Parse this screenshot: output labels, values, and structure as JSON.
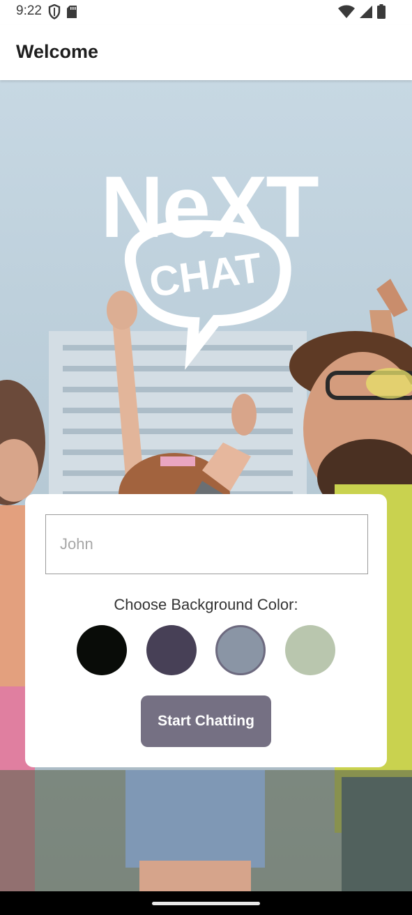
{
  "status_bar": {
    "time": "9:22",
    "left_icons": [
      "shield-icon",
      "sd-card-icon"
    ],
    "right_icons": [
      "wifi-icon",
      "cell-signal-icon",
      "battery-icon"
    ]
  },
  "app_bar": {
    "title": "Welcome"
  },
  "hero": {
    "logo_text_top": "NeXT",
    "logo_text_bubble": "CHAT"
  },
  "form": {
    "name_input": {
      "value": "",
      "placeholder": "John"
    },
    "color_label": "Choose Background Color:",
    "colors": [
      "#090C08",
      "#474056",
      "#8A95A5",
      "#B9C6AE"
    ],
    "selected_color_index": 2,
    "start_button_label": "Start Chatting",
    "button_color": "#757083"
  }
}
